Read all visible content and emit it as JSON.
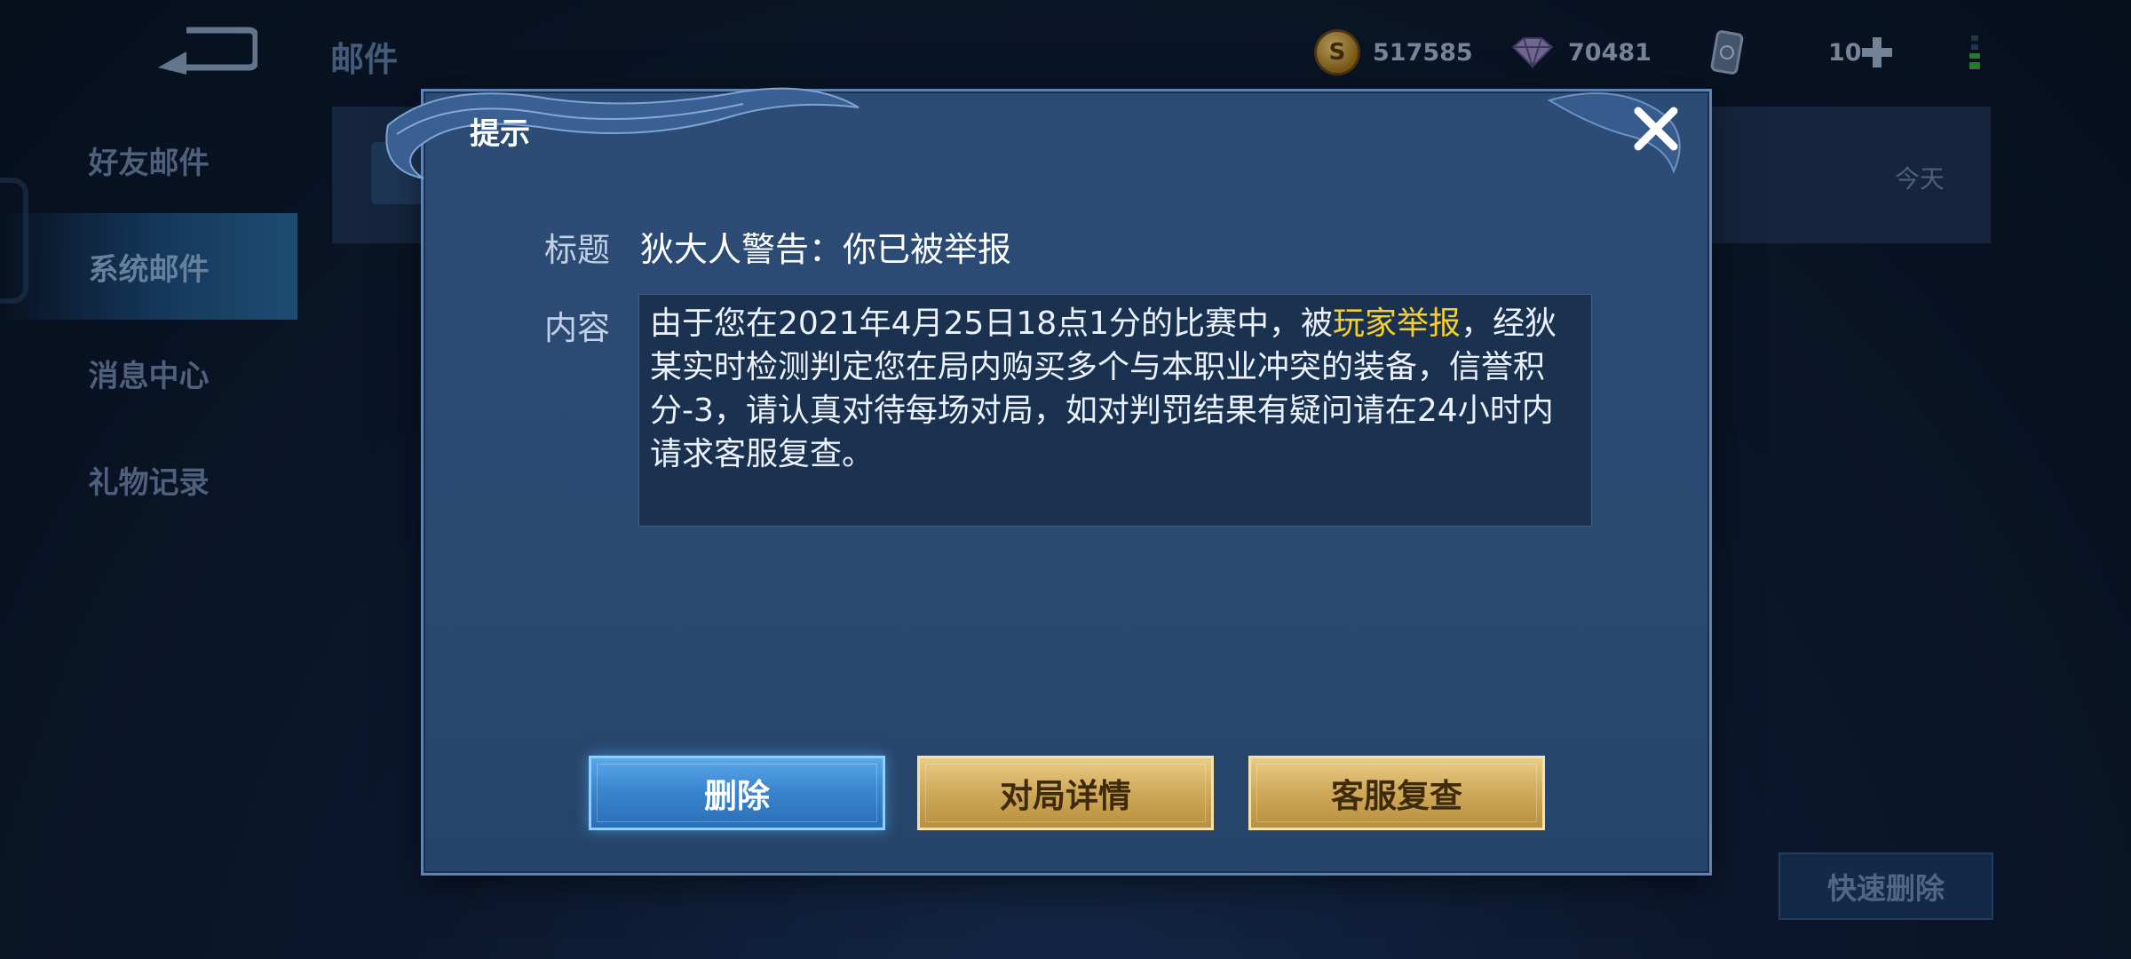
{
  "header": {
    "title": "邮件",
    "gold": "517585",
    "diamond": "70481",
    "tickets": "10"
  },
  "sidebar": {
    "items": [
      {
        "label": "好友邮件"
      },
      {
        "label": "系统邮件"
      },
      {
        "label": "消息中心"
      },
      {
        "label": "礼物记录"
      }
    ]
  },
  "mail_list": {
    "date": "今天"
  },
  "quick_delete_label": "快速删除",
  "dialog": {
    "title": "提示",
    "subject_label": "标题",
    "subject": "狄大人警告：你已被举报",
    "content_label": "内容",
    "content_before": "由于您在2021年4月25日18点1分的比赛中，被",
    "content_highlight": "玩家举报",
    "content_after": "，经狄某实时检测判定您在局内购买多个与本职业冲突的装备，信誉积分-3，请认真对待每场对局，如对判罚结果有疑问请在24小时内请求客服复查。",
    "buttons": {
      "delete": "删除",
      "match_details": "对局详情",
      "customer_review": "客服复查"
    }
  },
  "colors": {
    "highlight": "#f3d02c",
    "delete_button": "#3a86d0",
    "gold_button": "#cfa958"
  }
}
